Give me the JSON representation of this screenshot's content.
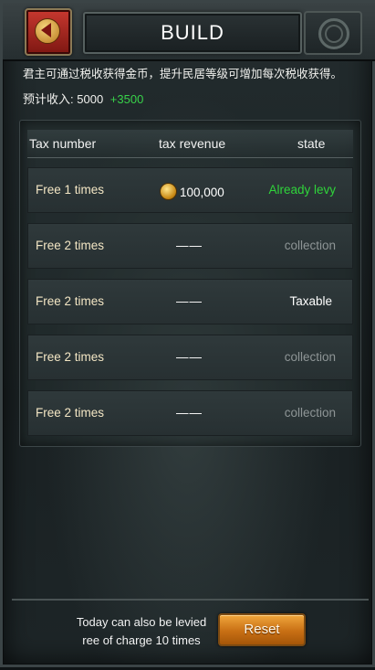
{
  "header": {
    "title": "BUILD",
    "back_icon": "back-arrow-icon",
    "ornament_icon": "celtic-knot-icon"
  },
  "info": {
    "description": "君主可通过税收获得金币，提升民居等级可增加每次税收获得。",
    "income_label": "预计收入:",
    "income_value": "5000",
    "income_bonus": "+3500"
  },
  "table": {
    "headers": [
      "Tax number",
      "tax revenue",
      "state"
    ],
    "rows": [
      {
        "times": "Free 1 times",
        "revenue": "100,000",
        "has_coin": true,
        "state": "Already levy",
        "state_kind": "levy"
      },
      {
        "times": "Free 2 times",
        "revenue": "——",
        "has_coin": false,
        "state": "collection",
        "state_kind": "collection"
      },
      {
        "times": "Free 2 times",
        "revenue": "——",
        "has_coin": false,
        "state": "Taxable",
        "state_kind": "taxable"
      },
      {
        "times": "Free 2 times",
        "revenue": "——",
        "has_coin": false,
        "state": "collection",
        "state_kind": "collection"
      },
      {
        "times": "Free 2 times",
        "revenue": "——",
        "has_coin": false,
        "state": "collection",
        "state_kind": "collection"
      }
    ]
  },
  "footer": {
    "line1": "Today can also be levied",
    "line2_prefix": "ree of charge",
    "remaining": "10",
    "line2_suffix": "times",
    "reset_label": "Reset"
  },
  "colors": {
    "levy": "#2fd43a",
    "collection": "#8e9596",
    "taxable": "#ffffff",
    "bonus": "#38d24a",
    "button": "#e08a22"
  }
}
